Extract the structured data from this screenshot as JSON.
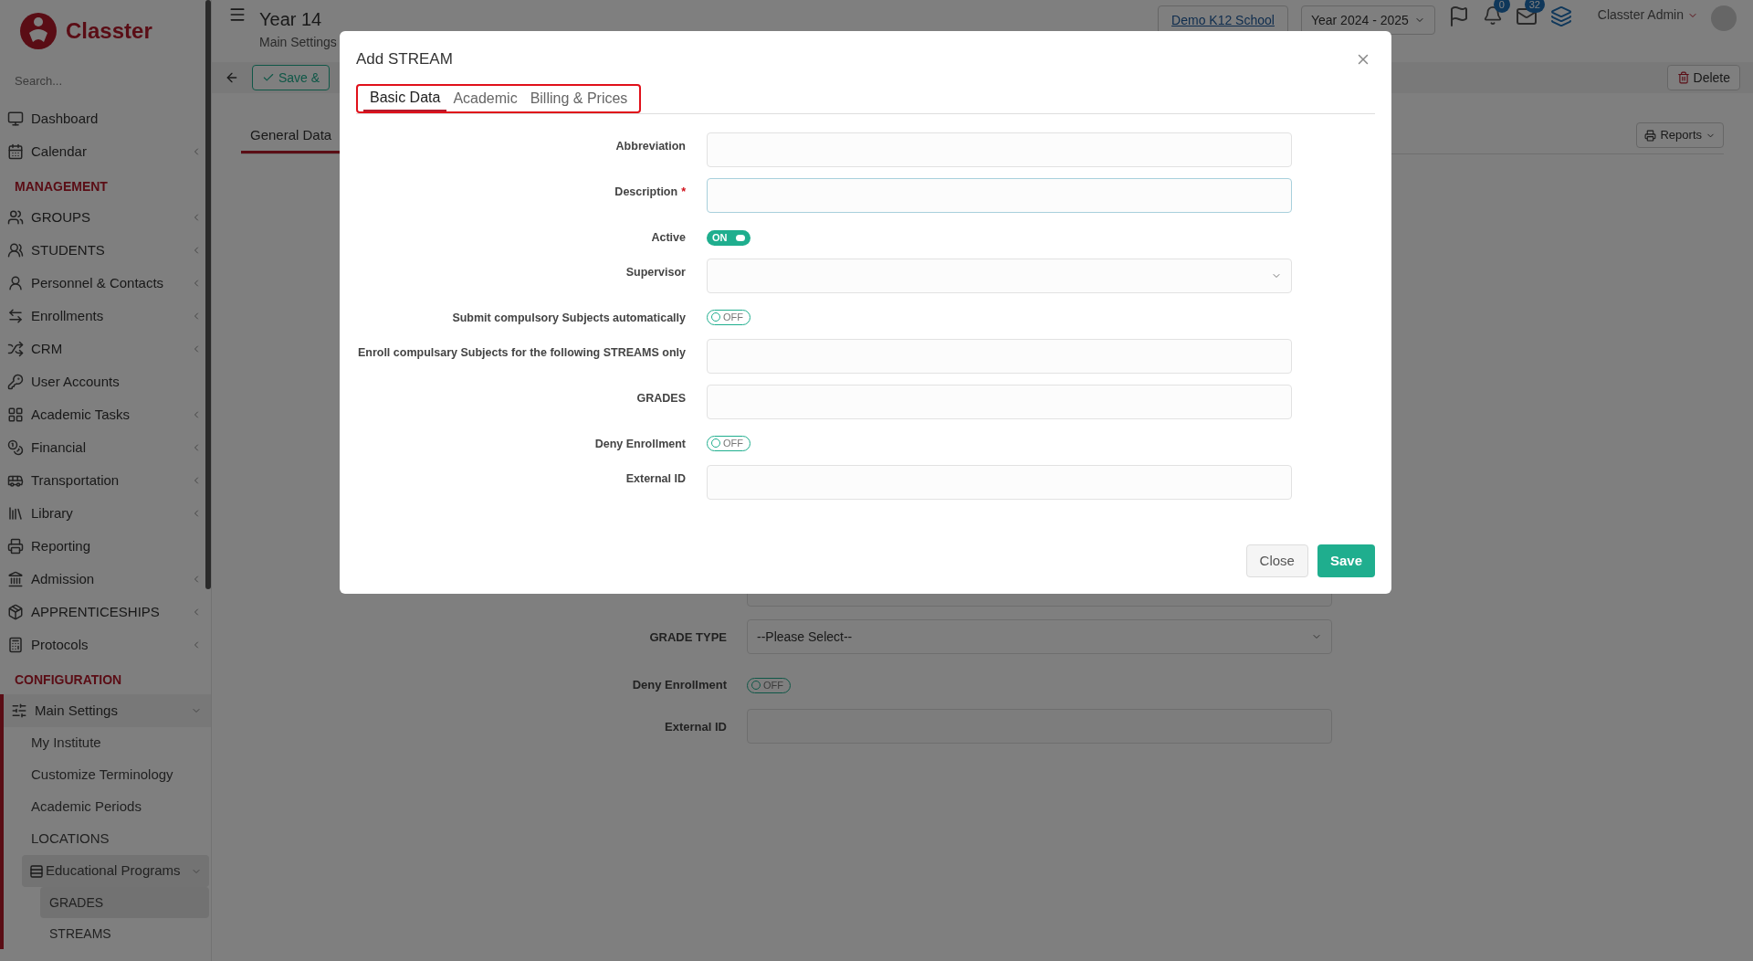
{
  "sidebar": {
    "brand": "Classter",
    "search": {
      "placeholder": "Search..."
    },
    "items": [
      {
        "kind": "link",
        "label": "Dashboard",
        "expandable": false
      },
      {
        "kind": "link",
        "label": "Calendar",
        "expandable": true
      },
      {
        "kind": "heading",
        "label": "MANAGEMENT"
      },
      {
        "kind": "link",
        "label": "GROUPS",
        "expandable": true
      },
      {
        "kind": "link",
        "label": "STUDENTS",
        "expandable": true
      },
      {
        "kind": "link",
        "label": "Personnel & Contacts",
        "expandable": true
      },
      {
        "kind": "link",
        "label": "Enrollments",
        "expandable": true
      },
      {
        "kind": "link",
        "label": "CRM",
        "expandable": true
      },
      {
        "kind": "link",
        "label": "User Accounts",
        "expandable": false
      },
      {
        "kind": "link",
        "label": "Academic Tasks",
        "expandable": true
      },
      {
        "kind": "link",
        "label": "Financial",
        "expandable": true
      },
      {
        "kind": "link",
        "label": "Transportation",
        "expandable": true
      },
      {
        "kind": "link",
        "label": "Library",
        "expandable": true
      },
      {
        "kind": "link",
        "label": "Reporting",
        "expandable": false
      },
      {
        "kind": "link",
        "label": "Admission",
        "expandable": true
      },
      {
        "kind": "link",
        "label": "APPRENTICESHIPS",
        "expandable": true
      },
      {
        "kind": "link",
        "label": "Protocols",
        "expandable": true
      },
      {
        "kind": "heading",
        "label": "CONFIGURATION"
      },
      {
        "kind": "link",
        "label": "Main Settings",
        "expandable": true,
        "expanded": true,
        "children": [
          {
            "label": "My Institute"
          },
          {
            "label": "Customize Terminology"
          },
          {
            "label": "Academic Periods"
          },
          {
            "label": "LOCATIONS"
          },
          {
            "label": "Educational Programs",
            "expanded": true,
            "children": [
              {
                "label": "GRADES",
                "selected": true
              },
              {
                "label": "STREAMS",
                "selected": false
              }
            ]
          }
        ]
      }
    ]
  },
  "header": {
    "title": "Year 14",
    "subtitle": "Main Settings",
    "school": "Demo K12 School",
    "year": "Year 2024 - 2025",
    "notifications": "0",
    "messages": "32",
    "user": "Classter Admin"
  },
  "toolbar": {
    "save_label": "Save &",
    "delete_label": "Delete"
  },
  "tabs": [
    {
      "label": "General Data",
      "selected": true
    }
  ],
  "reports_label": "Reports",
  "background_form": [
    {
      "kind": "text"
    },
    {
      "kind": "select",
      "label": "GRADE TYPE",
      "value": "--Please Select--"
    },
    {
      "kind": "toggle",
      "label": "Deny Enrollment",
      "on": false,
      "toggle_text": "OFF"
    },
    {
      "kind": "text",
      "label": "External ID"
    }
  ],
  "modal": {
    "title": "Add STREAM",
    "highlighted_tabs": true,
    "tabs": [
      {
        "label": "Basic Data",
        "selected": true
      },
      {
        "label": "Academic",
        "selected": false
      },
      {
        "label": "Billing & Prices",
        "selected": false
      }
    ],
    "fields": [
      {
        "kind": "text",
        "label": "Abbreviation",
        "focused": false
      },
      {
        "kind": "text",
        "label": "Description",
        "required_mark": "*",
        "focused": true
      },
      {
        "kind": "toggle",
        "label": "Active",
        "on": true,
        "toggle_text": "ON"
      },
      {
        "kind": "select",
        "label": "Supervisor"
      },
      {
        "kind": "toggle",
        "label": "Submit compulsory Subjects automatically",
        "on": false,
        "toggle_text": "OFF"
      },
      {
        "kind": "text",
        "label": "Enroll compulsary Subjects for the following STREAMS only",
        "focused": false
      },
      {
        "kind": "text",
        "label": "GRADES",
        "focused": false
      },
      {
        "kind": "toggle",
        "label": "Deny Enrollment",
        "on": false,
        "toggle_text": "OFF"
      },
      {
        "kind": "text",
        "label": "External ID",
        "focused": false
      }
    ],
    "buttons": [
      {
        "kind": "secondary",
        "label": "Close"
      },
      {
        "kind": "primary",
        "label": "Save"
      }
    ]
  }
}
